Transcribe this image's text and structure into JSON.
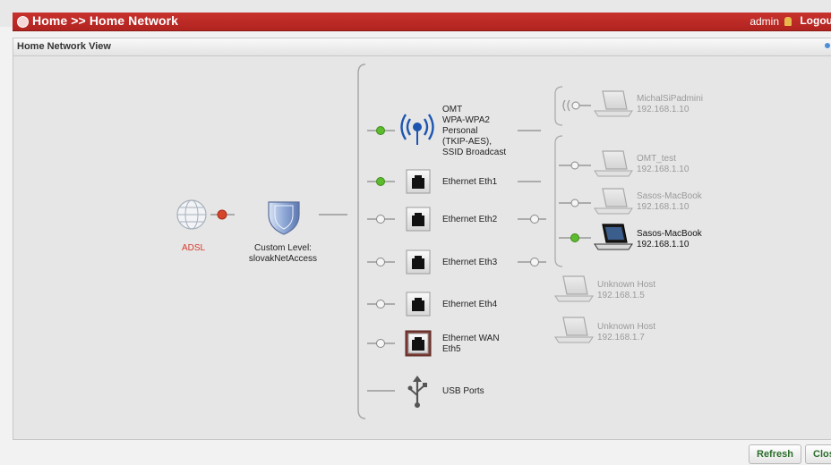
{
  "header": {
    "title": "Home >> Home Network",
    "user": "admin",
    "logout_label": "Logout"
  },
  "panel": {
    "title": "Home Network View"
  },
  "internet": {
    "label": "ADSL"
  },
  "security": {
    "label_line1": "Custom Level:",
    "label_line2": "slovakNetAccess"
  },
  "interfaces": [
    {
      "lines": [
        "OMT",
        "WPA-WPA2",
        "Personal",
        "(TKIP-AES),",
        "SSID Broadcast"
      ]
    },
    {
      "lines": [
        "Ethernet Eth1"
      ]
    },
    {
      "lines": [
        "Ethernet Eth2"
      ]
    },
    {
      "lines": [
        "Ethernet Eth3"
      ]
    },
    {
      "lines": [
        "Ethernet Eth4"
      ]
    },
    {
      "lines": [
        "Ethernet WAN",
        "Eth5"
      ]
    },
    {
      "lines": [
        "USB Ports"
      ]
    }
  ],
  "devices": [
    {
      "name": "MichalSiPadmini",
      "ip": "192.168.1.10"
    },
    {
      "name": "OMT_test",
      "ip": "192.168.1.10"
    },
    {
      "name": "Sasos-MacBook",
      "ip": "192.168.1.10"
    },
    {
      "name": "Sasos-MacBook",
      "ip": "192.168.1.10"
    },
    {
      "name": "Unknown Host",
      "ip": "192.168.1.5"
    },
    {
      "name": "Unknown Host",
      "ip": "192.168.1.7"
    }
  ],
  "footer": {
    "refresh_label": "Refresh",
    "close_label": "Close"
  },
  "colors": {
    "header_red": "#b92a26",
    "status_green": "#5dbb2e",
    "status_red": "#d6452a"
  }
}
